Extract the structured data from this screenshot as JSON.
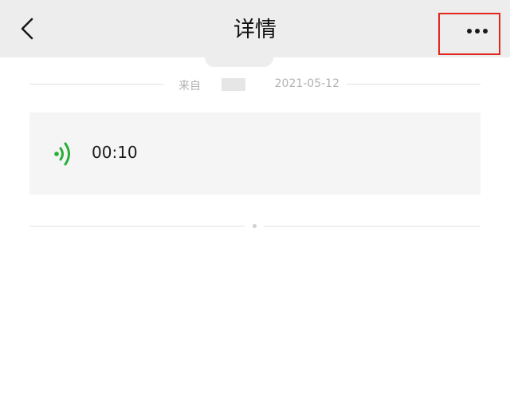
{
  "header": {
    "title": "详情",
    "back_icon": "chevron-left-icon",
    "more_icon": "more-dots-icon"
  },
  "source": {
    "label": "来自",
    "date": "2021-05-12"
  },
  "voice_message": {
    "duration": "00:10",
    "icon": "voice-wave-icon",
    "icon_color": "#2aae3a"
  },
  "colors": {
    "nav_background": "#ededed",
    "highlight_border": "#e0281e",
    "card_background": "#f5f5f5"
  }
}
